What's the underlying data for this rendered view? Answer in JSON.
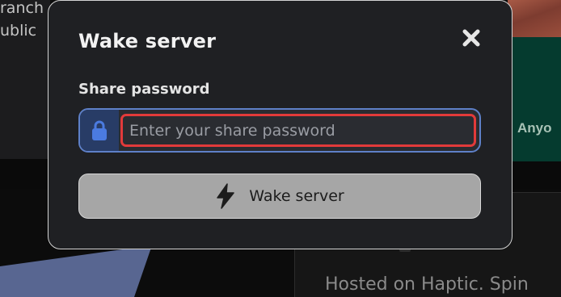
{
  "background": {
    "left_lines": [
      "ranch",
      "ublic"
    ],
    "right_label": "Anyo",
    "card_text": "Hosted on Haptic. Spin"
  },
  "modal": {
    "title": "Wake server",
    "close_icon": "close-icon",
    "password_label": "Share password",
    "password_value": "",
    "password_placeholder": "Enter your share password",
    "lock_icon": "lock-icon",
    "wake_button_label": "Wake server",
    "wake_button_icon": "lightning-bolt-icon"
  },
  "colors": {
    "modal_bg": "#1f2023",
    "input_border": "#5e80c8",
    "focus_ring": "#e23a3a",
    "button_bg": "#a6a6a6",
    "lock_accent": "#4b7be0"
  }
}
